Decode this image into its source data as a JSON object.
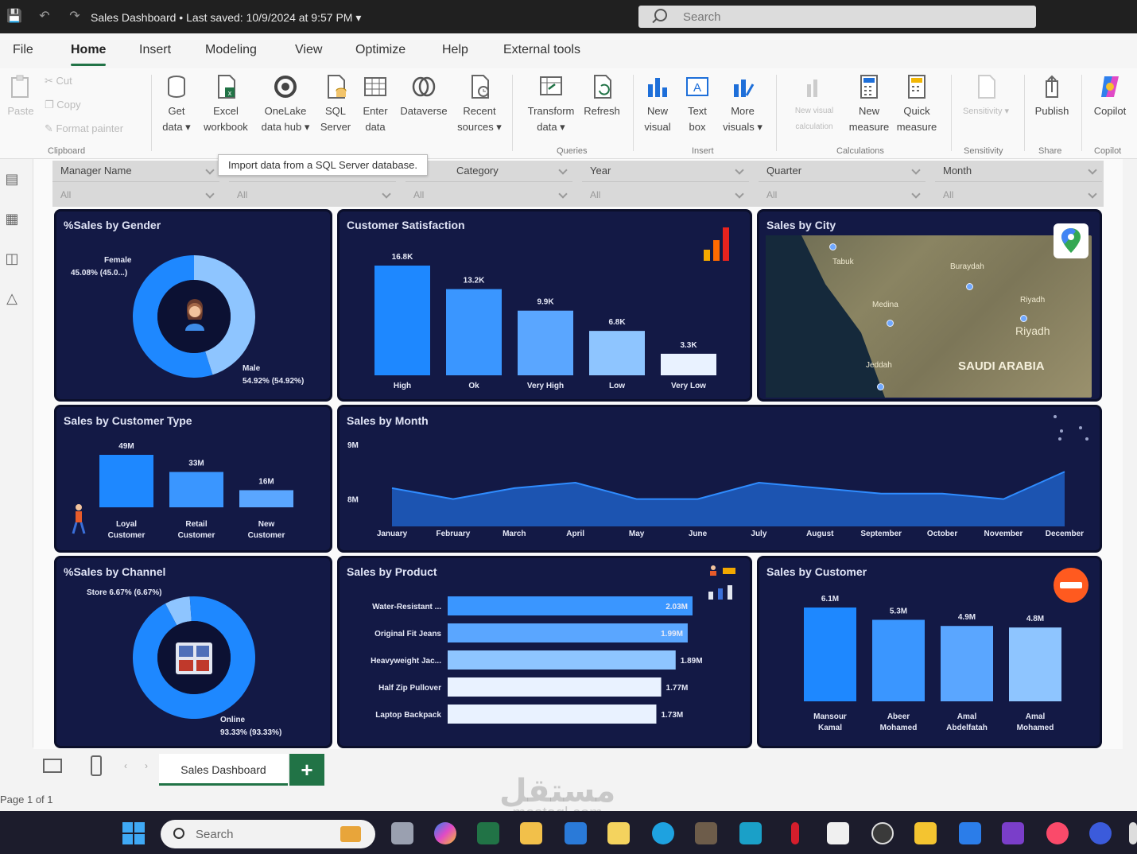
{
  "window": {
    "title": "Sales Dashboard • Last saved: 10/9/2024 at 9:57 PM ▾",
    "search_placeholder": "Search"
  },
  "menu": {
    "tabs": [
      "File",
      "Home",
      "Insert",
      "Modeling",
      "View",
      "Optimize",
      "Help",
      "External tools"
    ],
    "active": "Home"
  },
  "ribbon": {
    "clipboard": {
      "paste": "Paste",
      "cut": "Cut",
      "copy": "Copy",
      "format_painter": "Format painter",
      "group": "Clipboard"
    },
    "data": {
      "get_data": "Get data ▾",
      "excel": "Excel workbook",
      "onelake": "OneLake data hub ▾",
      "sql": "SQL Server",
      "enter": "Enter data",
      "dataverse": "Dataverse",
      "recent": "Recent sources ▾",
      "group": "Data"
    },
    "queries": {
      "transform": "Transform data ▾",
      "refresh": "Refresh",
      "group": "Queries"
    },
    "insert": {
      "new_visual": "New visual",
      "text_box": "Text box",
      "more_visuals": "More visuals ▾",
      "group": "Insert"
    },
    "calculations": {
      "new_visual_calc": "New visual calculation",
      "new_measure": "New measure",
      "quick_measure": "Quick measure",
      "group": "Calculations"
    },
    "sensitivity": {
      "label": "Sensitivity ▾",
      "group": "Sensitivity"
    },
    "share": {
      "publish": "Publish",
      "group": "Share"
    },
    "copilot": {
      "label": "Copilot",
      "group": "Copilot"
    },
    "tooltip": "Import data from a SQL Server database."
  },
  "slicers": [
    {
      "label": "Manager Name",
      "value": "All"
    },
    {
      "label": "",
      "value": "All"
    },
    {
      "label": "Category",
      "value": "All"
    },
    {
      "label": "Year",
      "value": "All"
    },
    {
      "label": "Quarter",
      "value": "All"
    },
    {
      "label": "Month",
      "value": "All"
    }
  ],
  "colors": {
    "card_bg": "#131945",
    "accent": "#1e88ff",
    "light": "#8ec5ff",
    "pale": "#e9f2ff"
  },
  "visuals": {
    "gender": {
      "title": "%Sales by Gender",
      "female_label": "Female",
      "female_value": "45.08% (45.0...)",
      "male_label": "Male",
      "male_value": "54.92% (54.92%)"
    },
    "satisfaction": {
      "title": "Customer Satisfaction"
    },
    "city": {
      "title": "Sales by City",
      "country": "SAUDI ARABIA",
      "cities": [
        "Tabuk",
        "Buraydah",
        "Medina",
        "Riyadh",
        "Riyadh",
        "Jeddah"
      ]
    },
    "customer_type": {
      "title": "Sales by Customer Type"
    },
    "month": {
      "title": "Sales by Month"
    },
    "channel": {
      "title": "%Sales by Channel",
      "store_value": "Store 6.67% (6.67%)",
      "online_label": "Online",
      "online_value": "93.33% (93.33%)"
    },
    "product": {
      "title": "Sales by Product"
    },
    "customer": {
      "title": "Sales by Customer"
    }
  },
  "chart_data": [
    {
      "type": "pie",
      "title": "%Sales by Gender",
      "labels": [
        "Female",
        "Male"
      ],
      "values": [
        45.08,
        54.92
      ]
    },
    {
      "type": "bar",
      "title": "Customer Satisfaction",
      "categories": [
        "High",
        "Ok",
        "Very High",
        "Low",
        "Very Low"
      ],
      "values": [
        16.8,
        13.2,
        9.9,
        6.8,
        3.3
      ],
      "data_labels": [
        "16.8K",
        "13.2K",
        "9.9K",
        "6.8K",
        "3.3K"
      ]
    },
    {
      "type": "bar",
      "title": "Sales by Customer Type",
      "categories": [
        "Loyal Customer",
        "Retail Customer",
        "New Customer"
      ],
      "values": [
        49,
        33,
        16
      ],
      "data_labels": [
        "49M",
        "33M",
        "16M"
      ]
    },
    {
      "type": "area",
      "title": "Sales by Month",
      "categories": [
        "January",
        "February",
        "March",
        "April",
        "May",
        "June",
        "July",
        "August",
        "September",
        "October",
        "November",
        "December"
      ],
      "values": [
        8.2,
        8.0,
        8.2,
        8.3,
        8.0,
        8.0,
        8.3,
        8.2,
        8.1,
        8.1,
        8.0,
        8.5
      ],
      "yticks": [
        "9M",
        "8M"
      ],
      "ylim": [
        7.5,
        9.1
      ]
    },
    {
      "type": "pie",
      "title": "%Sales by Channel",
      "labels": [
        "Store",
        "Online"
      ],
      "values": [
        6.67,
        93.33
      ]
    },
    {
      "type": "bar",
      "orientation": "horizontal",
      "title": "Sales by Product",
      "categories": [
        "Water-Resistant ...",
        "Original Fit Jeans",
        "Heavyweight Jac...",
        "Half Zip Pullover",
        "Laptop Backpack"
      ],
      "values": [
        2.03,
        1.99,
        1.89,
        1.77,
        1.73
      ],
      "data_labels": [
        "2.03M",
        "1.99M",
        "1.89M",
        "1.77M",
        "1.73M"
      ]
    },
    {
      "type": "bar",
      "title": "Sales by Customer",
      "categories": [
        "Mansour Kamal",
        "Abeer Mohamed",
        "Amal Abdelfatah",
        "Amal Mohamed"
      ],
      "values": [
        6.1,
        5.3,
        4.9,
        4.8
      ],
      "data_labels": [
        "6.1M",
        "5.3M",
        "4.9M",
        "4.8M"
      ]
    }
  ],
  "footer": {
    "page_tab": "Sales Dashboard",
    "add_page": "+",
    "page_info": "Page 1 of 1",
    "watermark_ar": "مستقل",
    "watermark_en": "mostaql.com"
  },
  "taskbar": {
    "search_placeholder": "Search"
  }
}
